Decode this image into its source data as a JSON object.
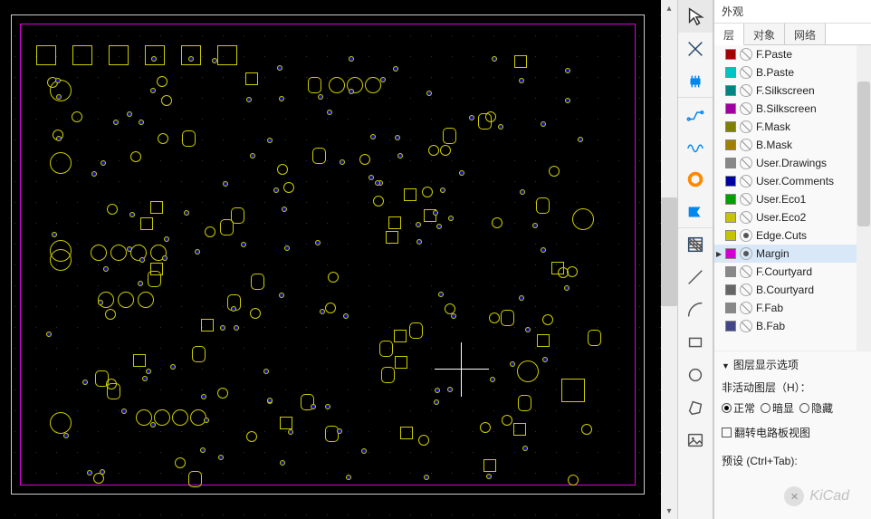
{
  "rp_title": "外观",
  "tabs": [
    {
      "id": "layer",
      "label": "层",
      "active": true
    },
    {
      "id": "object",
      "label": "对象",
      "active": false
    },
    {
      "id": "net",
      "label": "网络",
      "active": false
    }
  ],
  "layers": [
    {
      "name": "F.Paste",
      "color": "#a00000",
      "visible": false
    },
    {
      "name": "B.Paste",
      "color": "#00c4c4",
      "visible": false
    },
    {
      "name": "F.Silkscreen",
      "color": "#008484",
      "visible": false
    },
    {
      "name": "B.Silkscreen",
      "color": "#a000a0",
      "visible": false
    },
    {
      "name": "F.Mask",
      "color": "#808000",
      "visible": false
    },
    {
      "name": "B.Mask",
      "color": "#a08000",
      "visible": false
    },
    {
      "name": "User.Drawings",
      "color": "#888888",
      "visible": false
    },
    {
      "name": "User.Comments",
      "color": "#0000a0",
      "visible": false
    },
    {
      "name": "User.Eco1",
      "color": "#00a000",
      "visible": false
    },
    {
      "name": "User.Eco2",
      "color": "#c4c400",
      "visible": false
    },
    {
      "name": "Edge.Cuts",
      "color": "#c4c400",
      "visible": true
    },
    {
      "name": "Margin",
      "color": "#d000d0",
      "visible": true,
      "selected": true
    },
    {
      "name": "F.Courtyard",
      "color": "#888888",
      "visible": false
    },
    {
      "name": "B.Courtyard",
      "color": "#666666",
      "visible": false
    },
    {
      "name": "F.Fab",
      "color": "#888888",
      "visible": false
    },
    {
      "name": "B.Fab",
      "color": "#444488",
      "visible": false
    }
  ],
  "options": {
    "header": "图层显示选项",
    "inactive_label": "非活动图层（H）：",
    "radios": [
      {
        "label": "正常",
        "checked": true
      },
      {
        "label": "暗显",
        "checked": false
      },
      {
        "label": "隐藏",
        "checked": false
      }
    ],
    "flip_label": "翻转电路板视图",
    "preset_label": "预设 (Ctrl+Tab):"
  },
  "watermark": "KiCad",
  "toolbar": [
    {
      "name": "select-tool",
      "icon": "cursor",
      "active": true
    },
    {
      "name": "measure-tool",
      "icon": "cross"
    },
    {
      "name": "footprint-tool",
      "icon": "chip",
      "color": "#08e",
      "sep": true
    },
    {
      "name": "route-tool",
      "icon": "route",
      "color": "#08e"
    },
    {
      "name": "diff-pair-tool",
      "icon": "wave",
      "color": "#08e"
    },
    {
      "name": "via-tool",
      "icon": "donut",
      "color": "#f80"
    },
    {
      "name": "zone-tool",
      "icon": "zone",
      "color": "#08e",
      "sep": true
    },
    {
      "name": "hatch-tool",
      "icon": "hatch"
    },
    {
      "name": "line-tool",
      "icon": "line"
    },
    {
      "name": "arc-tool",
      "icon": "arc"
    },
    {
      "name": "rect-tool",
      "icon": "rect"
    },
    {
      "name": "circle-tool",
      "icon": "circle"
    },
    {
      "name": "poly-tool",
      "icon": "poly"
    },
    {
      "name": "image-tool",
      "icon": "image"
    }
  ],
  "chart_data": null
}
